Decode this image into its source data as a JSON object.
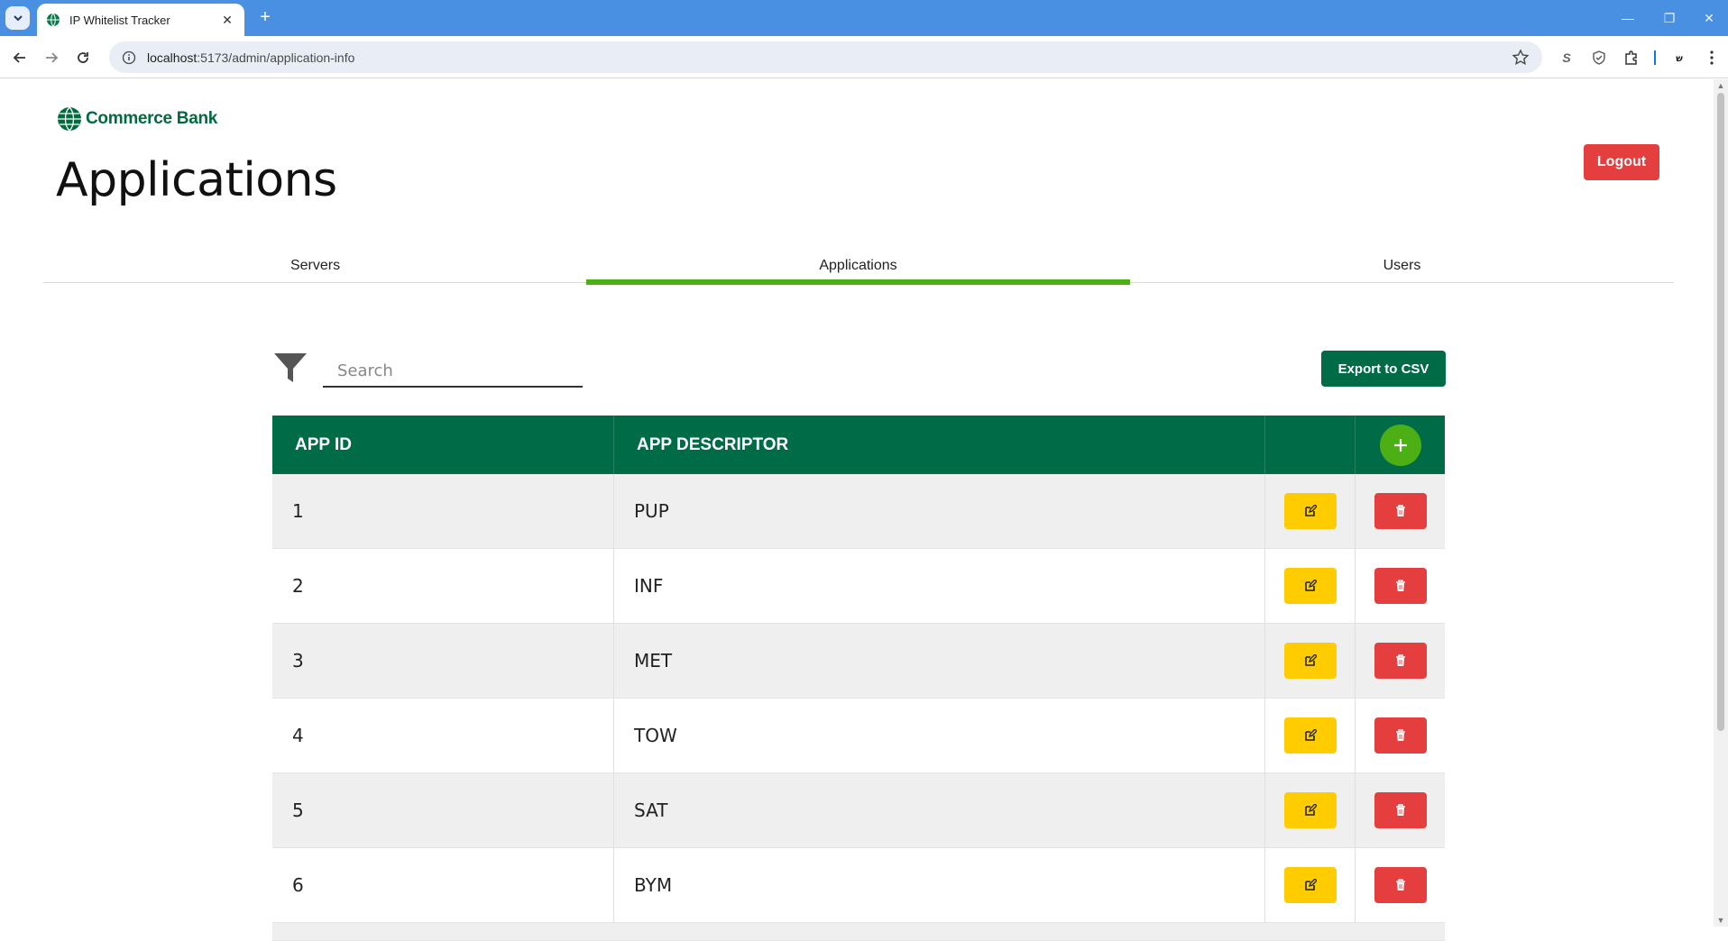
{
  "browser": {
    "tab_title": "IP Whitelist Tracker",
    "url_host": "localhost",
    "url_path": ":5173/admin/application-info",
    "extension_label": "S"
  },
  "header": {
    "logo_text": "Commerce Bank",
    "page_title": "Applications",
    "logout_label": "Logout"
  },
  "nav_tabs": [
    {
      "label": "Servers",
      "active": false
    },
    {
      "label": "Applications",
      "active": true
    },
    {
      "label": "Users",
      "active": false
    }
  ],
  "toolbar": {
    "search_placeholder": "Search",
    "export_label": "Export to CSV"
  },
  "table": {
    "columns": [
      "APP ID",
      "APP DESCRIPTOR"
    ],
    "rows": [
      {
        "id": "1",
        "descriptor": "PUP"
      },
      {
        "id": "2",
        "descriptor": "INF"
      },
      {
        "id": "3",
        "descriptor": "MET"
      },
      {
        "id": "4",
        "descriptor": "TOW"
      },
      {
        "id": "5",
        "descriptor": "SAT"
      },
      {
        "id": "6",
        "descriptor": "BYM"
      }
    ]
  },
  "colors": {
    "brand_green": "#006b47",
    "accent_green": "#4caf14",
    "danger_red": "#e53e3e",
    "edit_yellow": "#ffcc00",
    "chrome_blue": "#4a90e2"
  },
  "icons": [
    "tab-search-icon",
    "globe-icon",
    "close-icon",
    "plus-icon",
    "back-icon",
    "forward-icon",
    "reload-icon",
    "info-icon",
    "star-icon",
    "shield-icon",
    "puzzle-icon",
    "menu-icon",
    "filter-icon",
    "edit-icon",
    "trash-icon"
  ]
}
